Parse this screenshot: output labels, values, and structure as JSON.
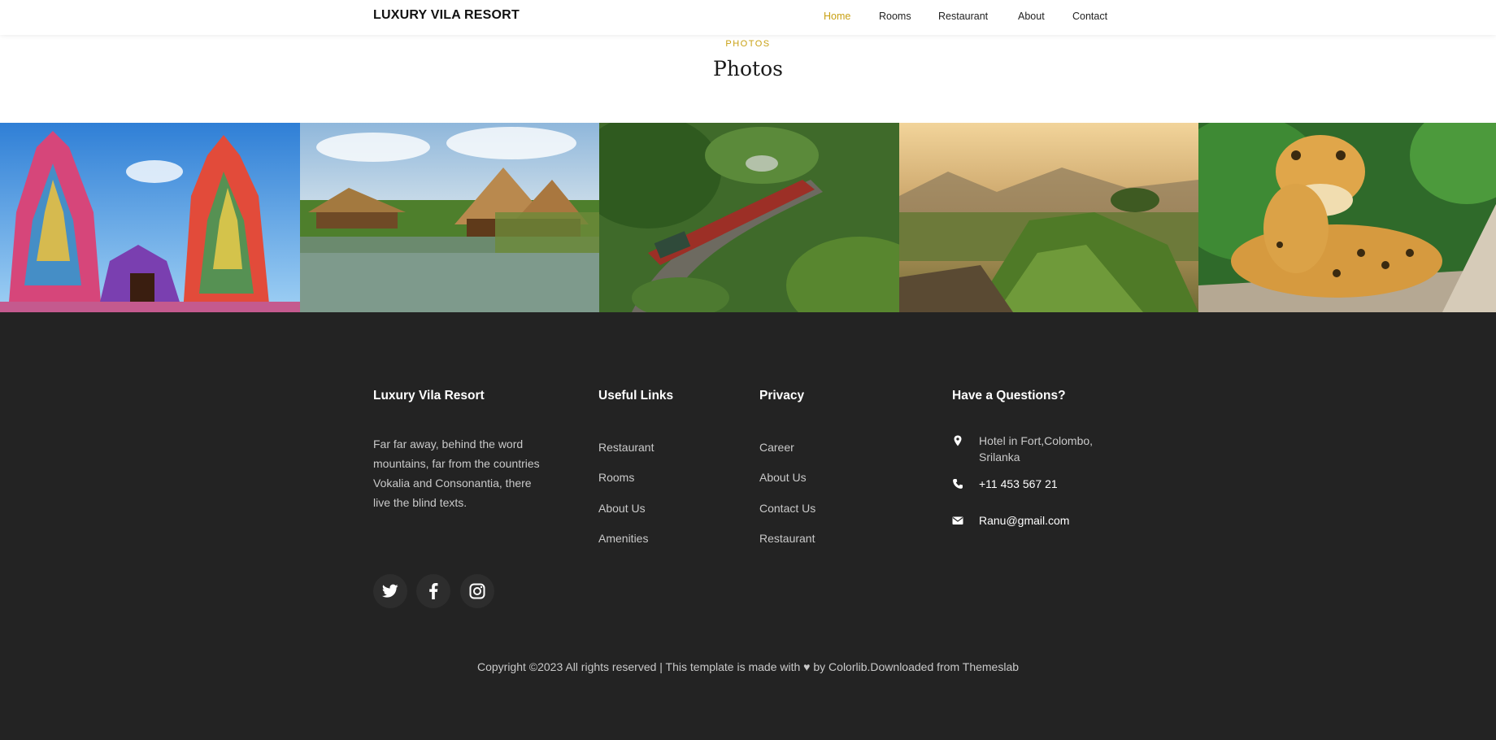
{
  "nav": {
    "brand": "LUXURY VILA RESORT",
    "links": [
      "Home",
      "Rooms",
      "Restaurant",
      "About",
      "Contact"
    ],
    "active": "Home"
  },
  "section": {
    "eyebrow": "PHOTOS",
    "title": "Photos"
  },
  "gallery": {
    "images": [
      "temple-photo",
      "lake-villa-photo",
      "train-bridge-photo",
      "rock-view-photo",
      "leopard-photo"
    ]
  },
  "footer": {
    "brand_heading": "Luxury Vila Resort",
    "about_text": "Far far away, behind the word mountains, far from the countries Vokalia and Consonantia, there live the blind texts.",
    "useful_links": {
      "heading": "Useful Links",
      "items": [
        "Restaurant",
        "Rooms",
        "About Us",
        "Amenities"
      ]
    },
    "privacy": {
      "heading": "Privacy",
      "items": [
        "Career",
        "About Us",
        "Contact Us",
        "Restaurant"
      ]
    },
    "contact": {
      "heading": "Have a Questions?",
      "address": "Hotel in Fort,Colombo, Srilanka",
      "phone": "+11 453 567 21",
      "email": "Ranu@gmail.com"
    },
    "social": [
      "twitter-icon",
      "facebook-icon",
      "instagram-icon"
    ],
    "copyright": "Copyright ©2023 All rights reserved | This template is made with ♥ by Colorlib.Downloaded from Themeslab"
  },
  "colors": {
    "accent": "#c8a013",
    "footer_bg": "#232323",
    "header_bg": "#ffffff"
  }
}
